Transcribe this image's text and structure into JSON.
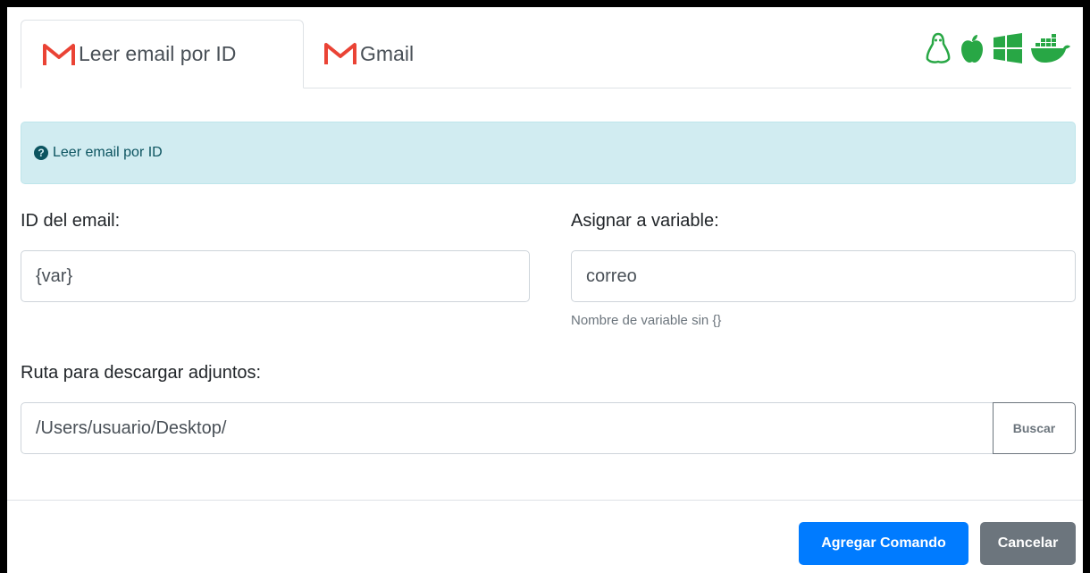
{
  "tabs": [
    {
      "label": "Leer email por ID",
      "icon": "gmail-icon",
      "active": true
    },
    {
      "label": "Gmail",
      "icon": "gmail-icon",
      "active": false
    }
  ],
  "os_icons": [
    "linux-icon",
    "apple-icon",
    "windows-icon",
    "docker-icon"
  ],
  "colors": {
    "os_icon": "#28a745",
    "gmail_red": "#ea4335",
    "primary": "#007bff",
    "secondary": "#6c757d",
    "alert_bg": "#d1ecf1"
  },
  "alert": {
    "text": "Leer email por ID",
    "icon": "question-circle-icon"
  },
  "form": {
    "email_id": {
      "label": "ID del email:",
      "value": "{var}"
    },
    "assign_var": {
      "label": "Asignar a variable:",
      "value": "correo",
      "hint": "Nombre de variable sin {}"
    },
    "download_path": {
      "label": "Ruta para descargar adjuntos:",
      "value": "/Users/usuario/Desktop/",
      "browse_label": "Buscar"
    }
  },
  "footer": {
    "add_label": "Agregar Comando",
    "cancel_label": "Cancelar"
  }
}
